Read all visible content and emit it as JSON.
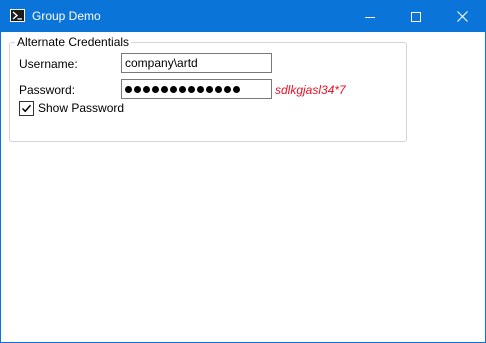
{
  "window": {
    "title": "Group Demo",
    "icon": "powershell-icon",
    "controls": [
      "minimize-icon",
      "maximize-icon",
      "close-icon"
    ],
    "accent_color": "#0a74d8"
  },
  "group": {
    "legend": "Alternate Credentials",
    "username": {
      "label": "Username:",
      "value": "company\\artd"
    },
    "password": {
      "label": "Password:",
      "masked_length": 13,
      "revealed_text": "sdlkgjasl34*7",
      "revealed_color": "#e81123"
    },
    "show_password": {
      "label": "Show Password",
      "checked": true
    }
  }
}
